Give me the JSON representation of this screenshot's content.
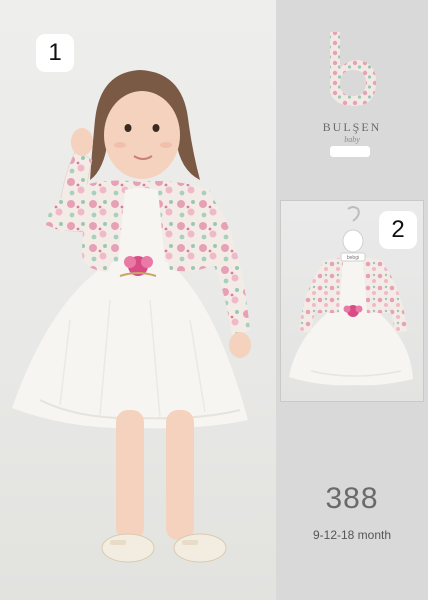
{
  "badges": {
    "main": "1",
    "secondary": "2"
  },
  "brand": {
    "name": "BULŞEN",
    "sub": "baby"
  },
  "hanger_tag": "bebgi",
  "product": {
    "code": "388",
    "sizes": "9-12-18 month"
  },
  "colors": {
    "background": "#dcdcdc",
    "dress_white": "#f7f5f2",
    "floral_pink": "#e6a1b6",
    "floral_green": "#9cc7b5",
    "flower_accent": "#d84d86"
  }
}
